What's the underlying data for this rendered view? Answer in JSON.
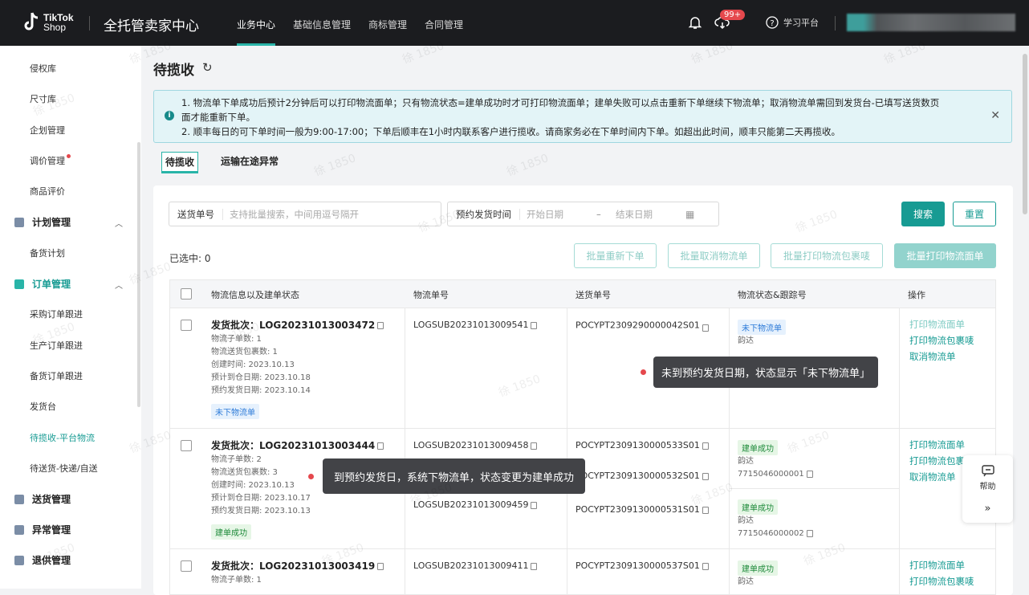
{
  "header": {
    "logo_line1": "TikTok",
    "logo_line2": "Shop",
    "app_title": "全托管卖家中心",
    "nav": [
      "业务中心",
      "基础信息管理",
      "商标管理",
      "合同管理"
    ],
    "notif_badge": "99+",
    "learn_label": "学习平台"
  },
  "sidebar": {
    "items_top": [
      "侵权库",
      "尺寸库",
      "企划管理",
      "调价管理",
      "商品评价"
    ],
    "group_plan": "计划管理",
    "plan_items": [
      "备货计划"
    ],
    "group_order": "订单管理",
    "order_items": [
      "采购订单跟进",
      "生产订单跟进",
      "备货订单跟进",
      "发货台",
      "待揽收-平台物流",
      "待送货-快递/自送"
    ],
    "group_ship": "送货管理",
    "group_exception": "异常管理",
    "group_return": "退供管理"
  },
  "page": {
    "title": "待揽收",
    "notice_line1": "1. 物流单下单成功后预计2分钟后可以打印物流面单；只有物流状态=建单成功时才可打印物流面单；建单失败可以点击重新下单继续下物流单；取消物流单需回到发货台-已填写送货数页",
    "notice_line1b": "面才能重新下单。",
    "notice_line2": "2. 顺丰每日的可下单时间一般为9:00-17:00；下单后顺丰在1小时内联系客户进行揽收。请商家务必在下单时间内下单。如超出此时间，顺丰只能第二天再揽收。",
    "tabs": [
      "待揽收",
      "运输在途异常"
    ]
  },
  "filters": {
    "delivery_label": "送货单号",
    "delivery_placeholder": "支持批量搜索，中间用逗号隔开",
    "date_label": "预约发货时间",
    "start_placeholder": "开始日期",
    "dash": "–",
    "end_placeholder": "结束日期",
    "search": "搜索",
    "reset": "重置"
  },
  "bulk": {
    "selected": "已选中: 0",
    "reorder": "批量重新下单",
    "cancel": "批量取消物流单",
    "print_pkg": "批量打印物流包裹唛",
    "print_label": "批量打印物流面单"
  },
  "table": {
    "headers": [
      "物流信息以及建单状态",
      "物流单号",
      "送货单号",
      "物流状态&跟踪号",
      "操作"
    ],
    "rows": [
      {
        "batch": "发货批次：LOG20231013003472",
        "lines": [
          "物流子单数: 1",
          "物流送货包裹数: 1",
          "创建时间: 2023.10.13",
          "预计到仓日期: 2023.10.18",
          "预约发货日期: 2023.10.14"
        ],
        "tag": "未下物流单",
        "logistics_no": "LOGSUB20231013009541",
        "delivery_no": "POCYPT2309290000042S01",
        "status": "未下物流单",
        "carrier": "韵达",
        "actions": [
          "打印物流面单",
          "打印物流包裹唛",
          "取消物流单"
        ]
      },
      {
        "batch": "发货批次：LOG20231013003444",
        "lines": [
          "物流子单数: 2",
          "物流送货包裹数: 3",
          "创建时间: 2023.10.13",
          "预计到仓日期: 2023.10.17",
          "预约发货日期: 2023.10.13"
        ],
        "tag": "建单成功",
        "logistics_no": "LOGSUB20231013009458",
        "logistics_no2": "LOGSUB20231013009459",
        "delivery_no": "POCYPT2309130000533S01",
        "delivery_no2": "POCYPT2309130000532S01",
        "delivery_no3": "POCYPT2309130000531S01",
        "status": "建单成功",
        "carrier": "韵达",
        "tracking": "7715046000001",
        "status2": "建单成功",
        "carrier2": "韵达",
        "tracking2": "7715046000002",
        "actions": [
          "打印物流面单",
          "打印物流包裹唛",
          "取消物流单"
        ]
      },
      {
        "batch": "发货批次：LOG20231013003419",
        "lines": [
          "物流子单数: 1"
        ],
        "logistics_no": "LOGSUB20231013009411",
        "delivery_no": "POCYPT2309130000537S01",
        "status": "建单成功",
        "carrier": "韵达",
        "actions": [
          "打印物流面单",
          "打印物流包裹唛"
        ]
      }
    ]
  },
  "tooltips": {
    "t1": "未到预约发货日期，状态显示「未下物流单」",
    "t2": "到预约发货日，系统下物流单，状态变更为建单成功"
  },
  "help": {
    "label": "帮助"
  },
  "watermark": "徐 1850"
}
